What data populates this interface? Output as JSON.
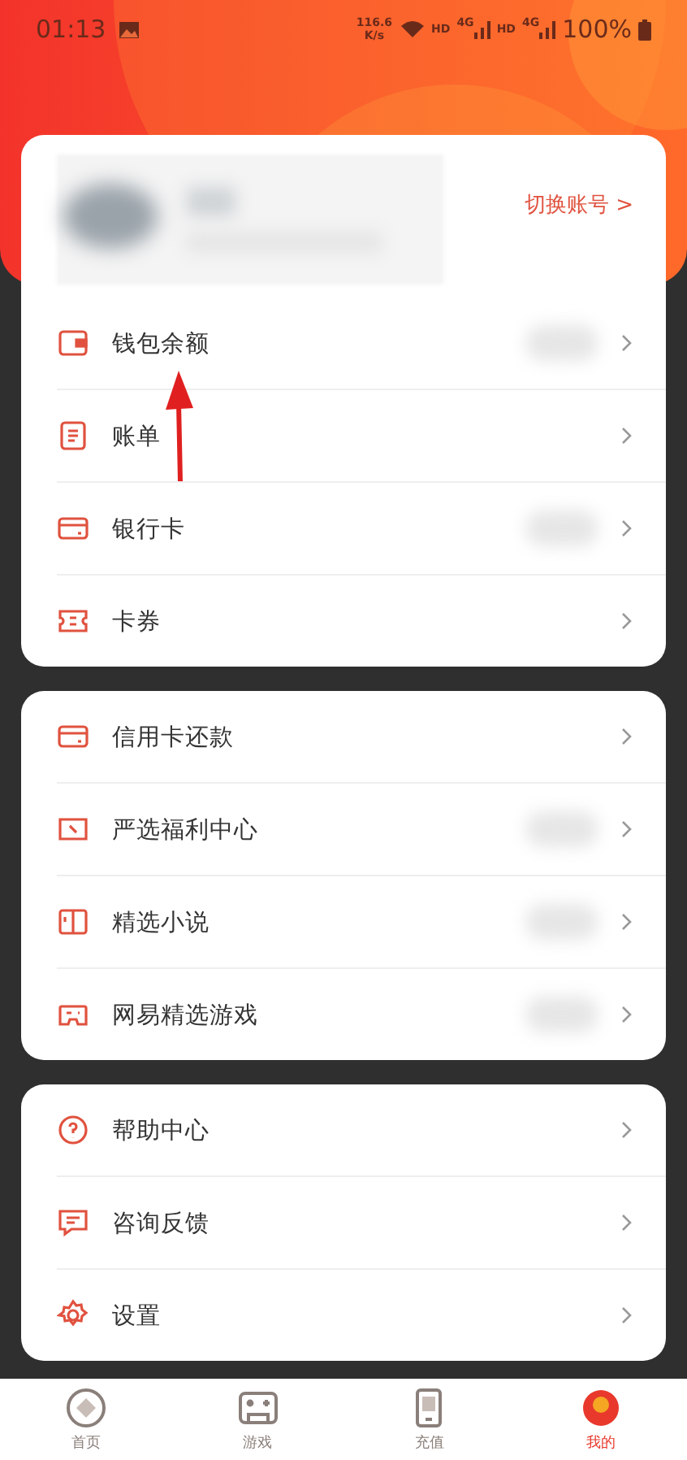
{
  "status_bar": {
    "time": "01:13",
    "speed": "116.6",
    "speed_unit": "K/s",
    "hd_1": "HD",
    "net_1": "4G",
    "hd_2": "HD",
    "net_2": "4G",
    "battery": "100%"
  },
  "account": {
    "switch_label": "切换账号",
    "switch_arrow": ">"
  },
  "sections": [
    {
      "items": [
        {
          "kind": "wallet",
          "label": "钱包余额",
          "blurred": true
        },
        {
          "kind": "bill",
          "label": "账单",
          "blurred": false
        },
        {
          "kind": "card",
          "label": "银行卡",
          "blurred": true
        },
        {
          "kind": "ticket",
          "label": "卡券",
          "blurred": false
        }
      ]
    },
    {
      "items": [
        {
          "kind": "creditcard",
          "label": "信用卡还款",
          "blurred": false
        },
        {
          "kind": "coupon",
          "label": "严选福利中心",
          "blurred": true
        },
        {
          "kind": "book",
          "label": "精选小说",
          "blurred": true
        },
        {
          "kind": "gamepad",
          "label": "网易精选游戏",
          "blurred": true
        }
      ]
    },
    {
      "items": [
        {
          "kind": "help",
          "label": "帮助中心",
          "blurred": false
        },
        {
          "kind": "chat",
          "label": "咨询反馈",
          "blurred": false
        },
        {
          "kind": "gear",
          "label": "设置",
          "blurred": false
        }
      ]
    }
  ],
  "tab_bar": [
    {
      "kind": "home",
      "label": "首页",
      "selected": false
    },
    {
      "kind": "game",
      "label": "游戏",
      "selected": false
    },
    {
      "kind": "recharge",
      "label": "充值",
      "selected": false
    },
    {
      "kind": "me",
      "label": "我的",
      "selected": true
    }
  ]
}
